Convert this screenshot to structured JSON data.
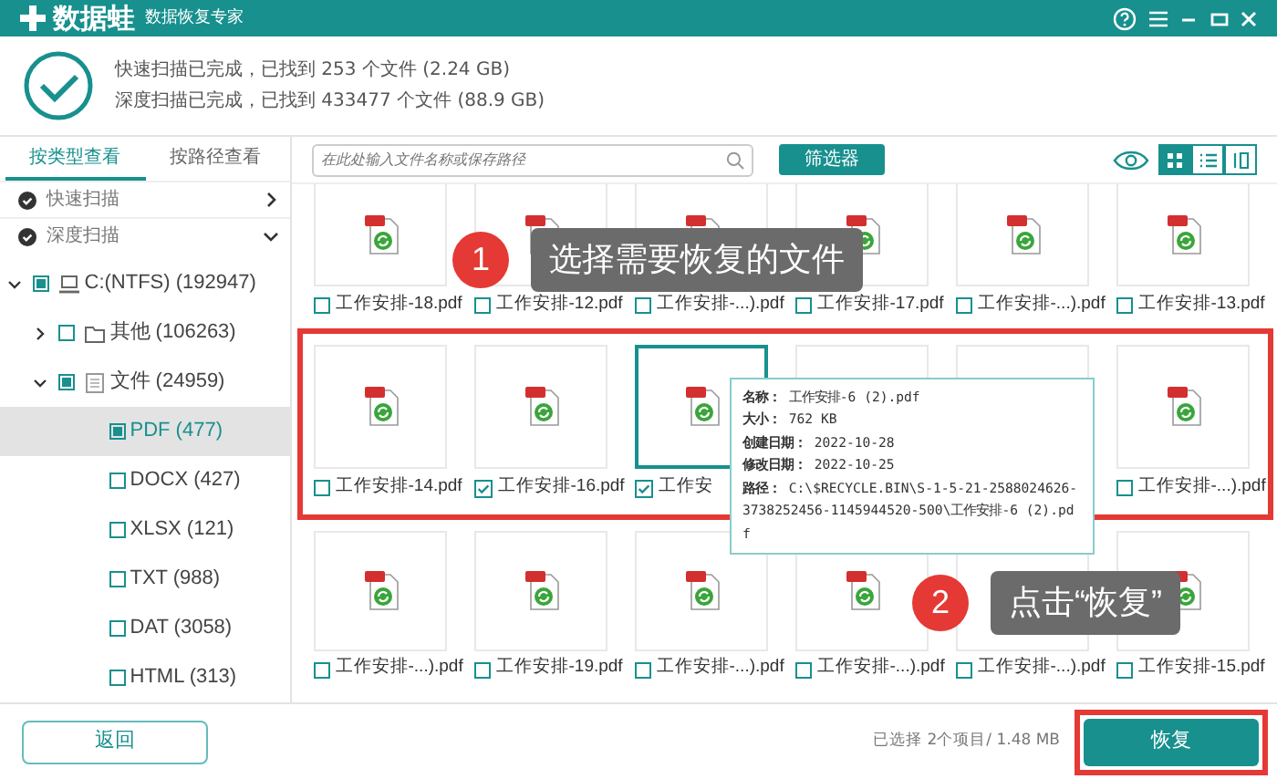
{
  "title_bar": {
    "app_name": "数据蛙",
    "subtitle": "数据恢复专家"
  },
  "scan_summary": [
    "快速扫描已完成，已找到 253 个文件 (2.24 GB)",
    "深度扫描已完成，已找到 433477 个文件 (88.9 GB)"
  ],
  "tabs": [
    {
      "label": "按类型查看",
      "selected": true
    },
    {
      "label": "按路径查看",
      "selected": false
    }
  ],
  "scan_sections": [
    {
      "label": "快速扫描",
      "expanded": false
    },
    {
      "label": "深度扫描",
      "expanded": true
    }
  ],
  "tree": [
    {
      "label": "C:(NTFS) (192947)",
      "kind": "drive",
      "checked": true,
      "expanded": true,
      "selected": false,
      "children": [
        {
          "label": "其他 (106263)",
          "kind": "folder",
          "checked": false,
          "expanded": false,
          "selected": false
        },
        {
          "label": "文件 (24959)",
          "kind": "doc",
          "checked": true,
          "expanded": true,
          "selected": false,
          "children": [
            {
              "label": "PDF (477)",
              "checked": true,
              "selected": true
            },
            {
              "label": "DOCX (427)",
              "checked": false,
              "selected": false
            },
            {
              "label": "XLSX (121)",
              "checked": false,
              "selected": false
            },
            {
              "label": "TXT (988)",
              "checked": false,
              "selected": false
            },
            {
              "label": "DAT (3058)",
              "checked": false,
              "selected": false
            },
            {
              "label": "HTML (313)",
              "checked": false,
              "selected": false
            }
          ]
        }
      ]
    }
  ],
  "search": {
    "placeholder": "在此处输入文件名称或保存路径"
  },
  "filter_button": "筛选器",
  "view_modes": [
    {
      "kind": "grid",
      "selected": true
    },
    {
      "kind": "list",
      "selected": false
    },
    {
      "kind": "columns",
      "selected": false
    }
  ],
  "file_rows": [
    {
      "files": [
        {
          "label": "工作安排-18.pdf",
          "checked": false,
          "selected": false
        },
        {
          "label": "工作安排-12.pdf",
          "checked": false,
          "selected": false
        },
        {
          "label": "工作安排-...).pdf",
          "checked": false,
          "selected": false
        },
        {
          "label": "工作安排-17.pdf",
          "checked": false,
          "selected": false
        },
        {
          "label": "工作安排-...).pdf",
          "checked": false,
          "selected": false
        },
        {
          "label": "工作安排-13.pdf",
          "checked": false,
          "selected": false
        }
      ]
    },
    {
      "highlighted": true,
      "files": [
        {
          "label": "工作安排-14.pdf",
          "checked": false,
          "selected": false
        },
        {
          "label": "工作安排-16.pdf",
          "checked": true,
          "selected": false
        },
        {
          "label": "工作安",
          "checked": true,
          "selected": true
        },
        {
          "selected": false
        },
        {
          "selected": false
        },
        {
          "label": "工作安排-...).pdf",
          "checked": false,
          "selected": false
        }
      ]
    },
    {
      "files": [
        {
          "label": "工作安排-...).pdf",
          "checked": false,
          "selected": false
        },
        {
          "label": "工作安排-19.pdf",
          "checked": false,
          "selected": false
        },
        {
          "label": "工作安排-...).pdf",
          "checked": false,
          "selected": false
        },
        {
          "label": "工作安排-...).pdf",
          "checked": false,
          "selected": false
        },
        {
          "label": "工作安排-...).pdf",
          "checked": false,
          "selected": false
        },
        {
          "label": "工作安排-15.pdf",
          "checked": false,
          "selected": false
        }
      ]
    }
  ],
  "file_info": [
    {
      "key": "名称：",
      "value": "工作安排-6 (2).pdf"
    },
    {
      "key": "大小：",
      "value": "762 KB"
    },
    {
      "key": "创建日期：",
      "value": "2022-10-28"
    },
    {
      "key": "修改日期：",
      "value": "2022-10-25"
    },
    {
      "key": "路径：",
      "value": "C:\\$RECYCLE.BIN\\S-1-5-21-2588024626-3738252456-1145944520-500\\工作安排-6 (2).pdf"
    }
  ],
  "callouts": [
    {
      "number": "1",
      "text": "选择需要恢复的文件"
    },
    {
      "number": "2",
      "text": "点击“恢复”"
    }
  ],
  "back_button": "返回",
  "selection_status": "已选择 2个项目/ 1.48 MB",
  "restore_button": "恢复"
}
